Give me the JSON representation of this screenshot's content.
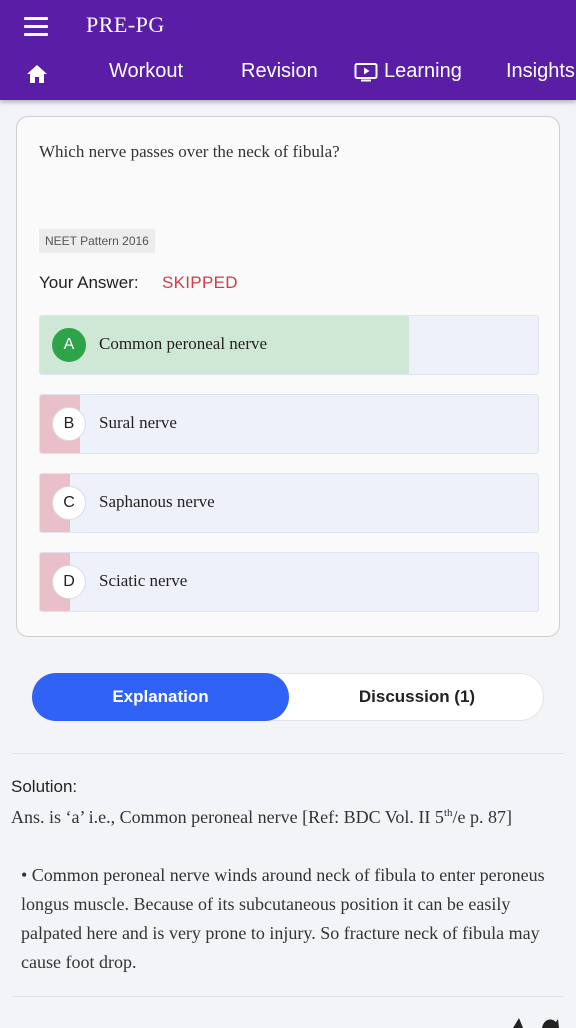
{
  "app": {
    "title": "PRE-PG"
  },
  "nav": {
    "home_icon": "home-icon",
    "tabs": [
      {
        "label": "Workout"
      },
      {
        "label": "Revision"
      },
      {
        "label": "Learning",
        "icon": "tv-play-icon"
      },
      {
        "label": "Insights"
      }
    ]
  },
  "question": {
    "text": "Which nerve passes over the neck of fibula?",
    "pattern": "NEET Pattern 2016",
    "your_answer_label": "Your Answer:",
    "your_answer_value": "SKIPPED",
    "options": [
      {
        "letter": "A",
        "text": "Common peroneal nerve",
        "correct": true,
        "percent": 0.74
      },
      {
        "letter": "B",
        "text": "Sural nerve",
        "correct": false,
        "percent": 0.08
      },
      {
        "letter": "C",
        "text": "Saphanous nerve",
        "correct": false,
        "percent": 0.06
      },
      {
        "letter": "D",
        "text": "Sciatic nerve",
        "correct": false,
        "percent": 0.06
      }
    ]
  },
  "segment": {
    "explanation": "Explanation",
    "discussion": "Discussion (1)"
  },
  "solution": {
    "heading": "Solution:",
    "ans_pre": "Ans. is ‘a’ i.e., Common peroneal nerve [Ref: BDC Vol. II 5",
    "ans_sup": "th",
    "ans_post": "/e p. 87]",
    "bullet": "• Common peroneal nerve winds around neck of fibula to enter peroneus longus muscle. Because of its subcutaneous position it can be easily palpated here and is very prone to injury. So fracture neck of fibula may cause foot drop."
  },
  "colors": {
    "appbar": "#5a1ea6",
    "correct_fill": "#cfe8d6",
    "wrong_fill": "#e9bfca",
    "accent": "#2f62f5",
    "skipped": "#d23b4a"
  }
}
